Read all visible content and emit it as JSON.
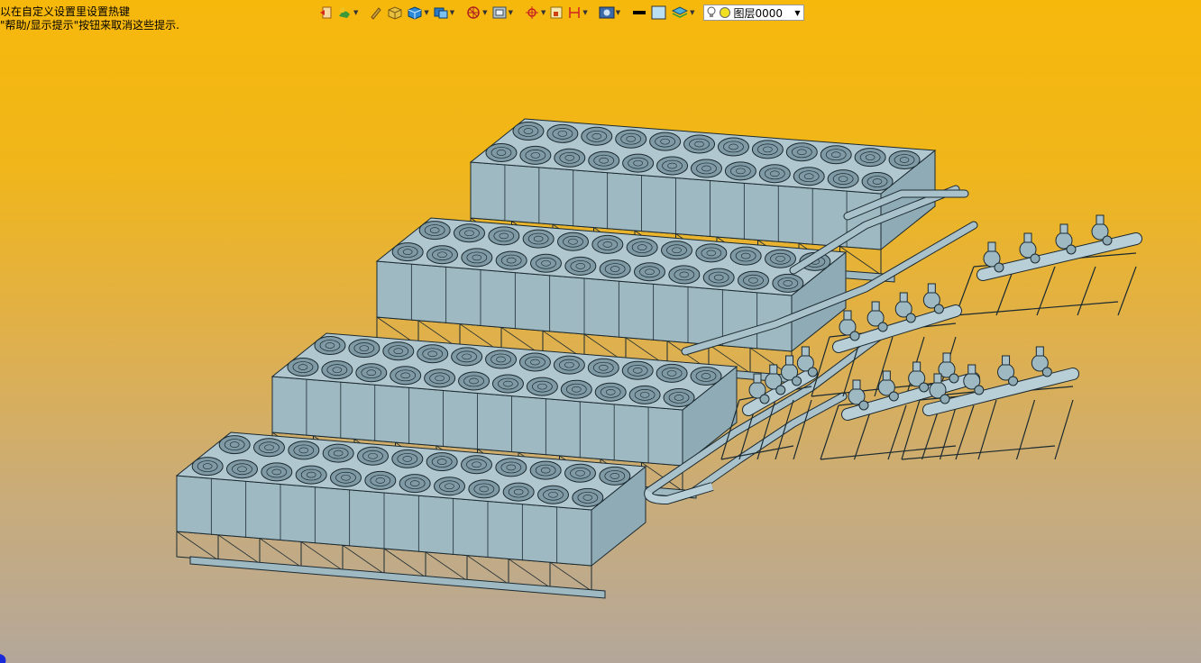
{
  "hints": {
    "line1": "以在自定义设置里设置热键",
    "line2": "\"帮助/显示提示\"按钮来取消这些提示."
  },
  "toolbar": {
    "tools": [
      {
        "name": "undo-icon",
        "has_dropdown": false
      },
      {
        "name": "paint-icon",
        "has_dropdown": true
      },
      {
        "name": "pen-icon",
        "has_dropdown": false
      },
      {
        "name": "box-material-icon",
        "has_dropdown": false
      },
      {
        "name": "cube-icon",
        "has_dropdown": true
      },
      {
        "name": "render-icon",
        "has_dropdown": true
      },
      {
        "name": "orbit-icon",
        "has_dropdown": true
      },
      {
        "name": "view-frame-icon",
        "has_dropdown": true
      },
      {
        "name": "crosshair-icon",
        "has_dropdown": true
      },
      {
        "name": "zoom-box-icon",
        "has_dropdown": false
      },
      {
        "name": "dimension-icon",
        "has_dropdown": true
      },
      {
        "name": "display-mode-icon",
        "has_dropdown": true
      },
      {
        "name": "line-color-icon",
        "has_dropdown": false
      },
      {
        "name": "fill-color-icon",
        "has_dropdown": false
      },
      {
        "name": "layers-icon",
        "has_dropdown": true
      }
    ],
    "layer": {
      "name": "图层0000",
      "visible_icon": "lightbulb-icon",
      "color_icon": "yellow-circle-icon"
    }
  },
  "colors": {
    "model_fill": "#9fb9c3",
    "model_stroke": "#1b2a30",
    "fan_fill": "#7f9aa5",
    "bg_top": "#f7b80c",
    "bg_bottom": "#b4a79a"
  }
}
